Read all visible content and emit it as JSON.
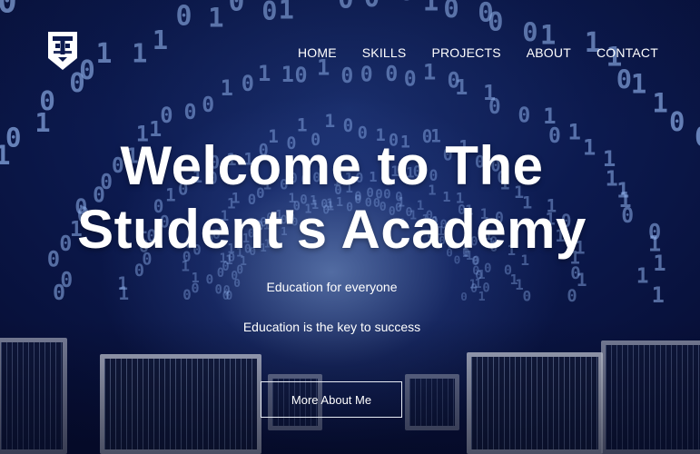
{
  "nav": {
    "items": [
      {
        "label": "HOME"
      },
      {
        "label": "SKILLS"
      },
      {
        "label": "PROJECTS"
      },
      {
        "label": "ABOUT"
      },
      {
        "label": "CONTACT"
      }
    ]
  },
  "hero": {
    "title_line1": "Welcome to The",
    "title_line2": "Student's Academy",
    "tagline1": "Education for everyone",
    "tagline2": "Education is the key to success",
    "cta_label": "More About Me"
  },
  "colors": {
    "background_dark": "#08123a",
    "background_glow": "#8cafe6",
    "text": "#ffffff"
  },
  "icons": {
    "logo": "ts-shield-logo"
  }
}
